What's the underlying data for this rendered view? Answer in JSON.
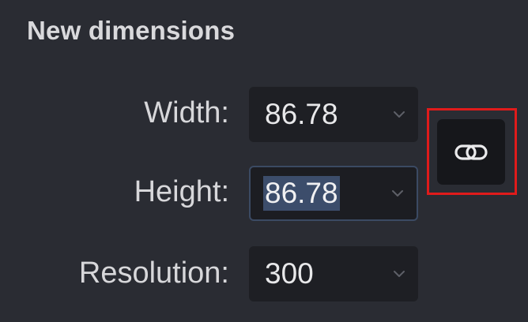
{
  "section": {
    "title": "New dimensions"
  },
  "fields": {
    "width": {
      "label": "Width:",
      "value": "86.78"
    },
    "height": {
      "label": "Height:",
      "value": "86.78"
    },
    "resolution": {
      "label": "Resolution:",
      "value": "300"
    }
  },
  "link_button": {
    "icon": "link-icon",
    "state": "linked"
  },
  "colors": {
    "background": "#2a2c33",
    "field_background": "#1e1f24",
    "selection": "#3c4d6b",
    "highlight_outline": "#e01b1b"
  }
}
